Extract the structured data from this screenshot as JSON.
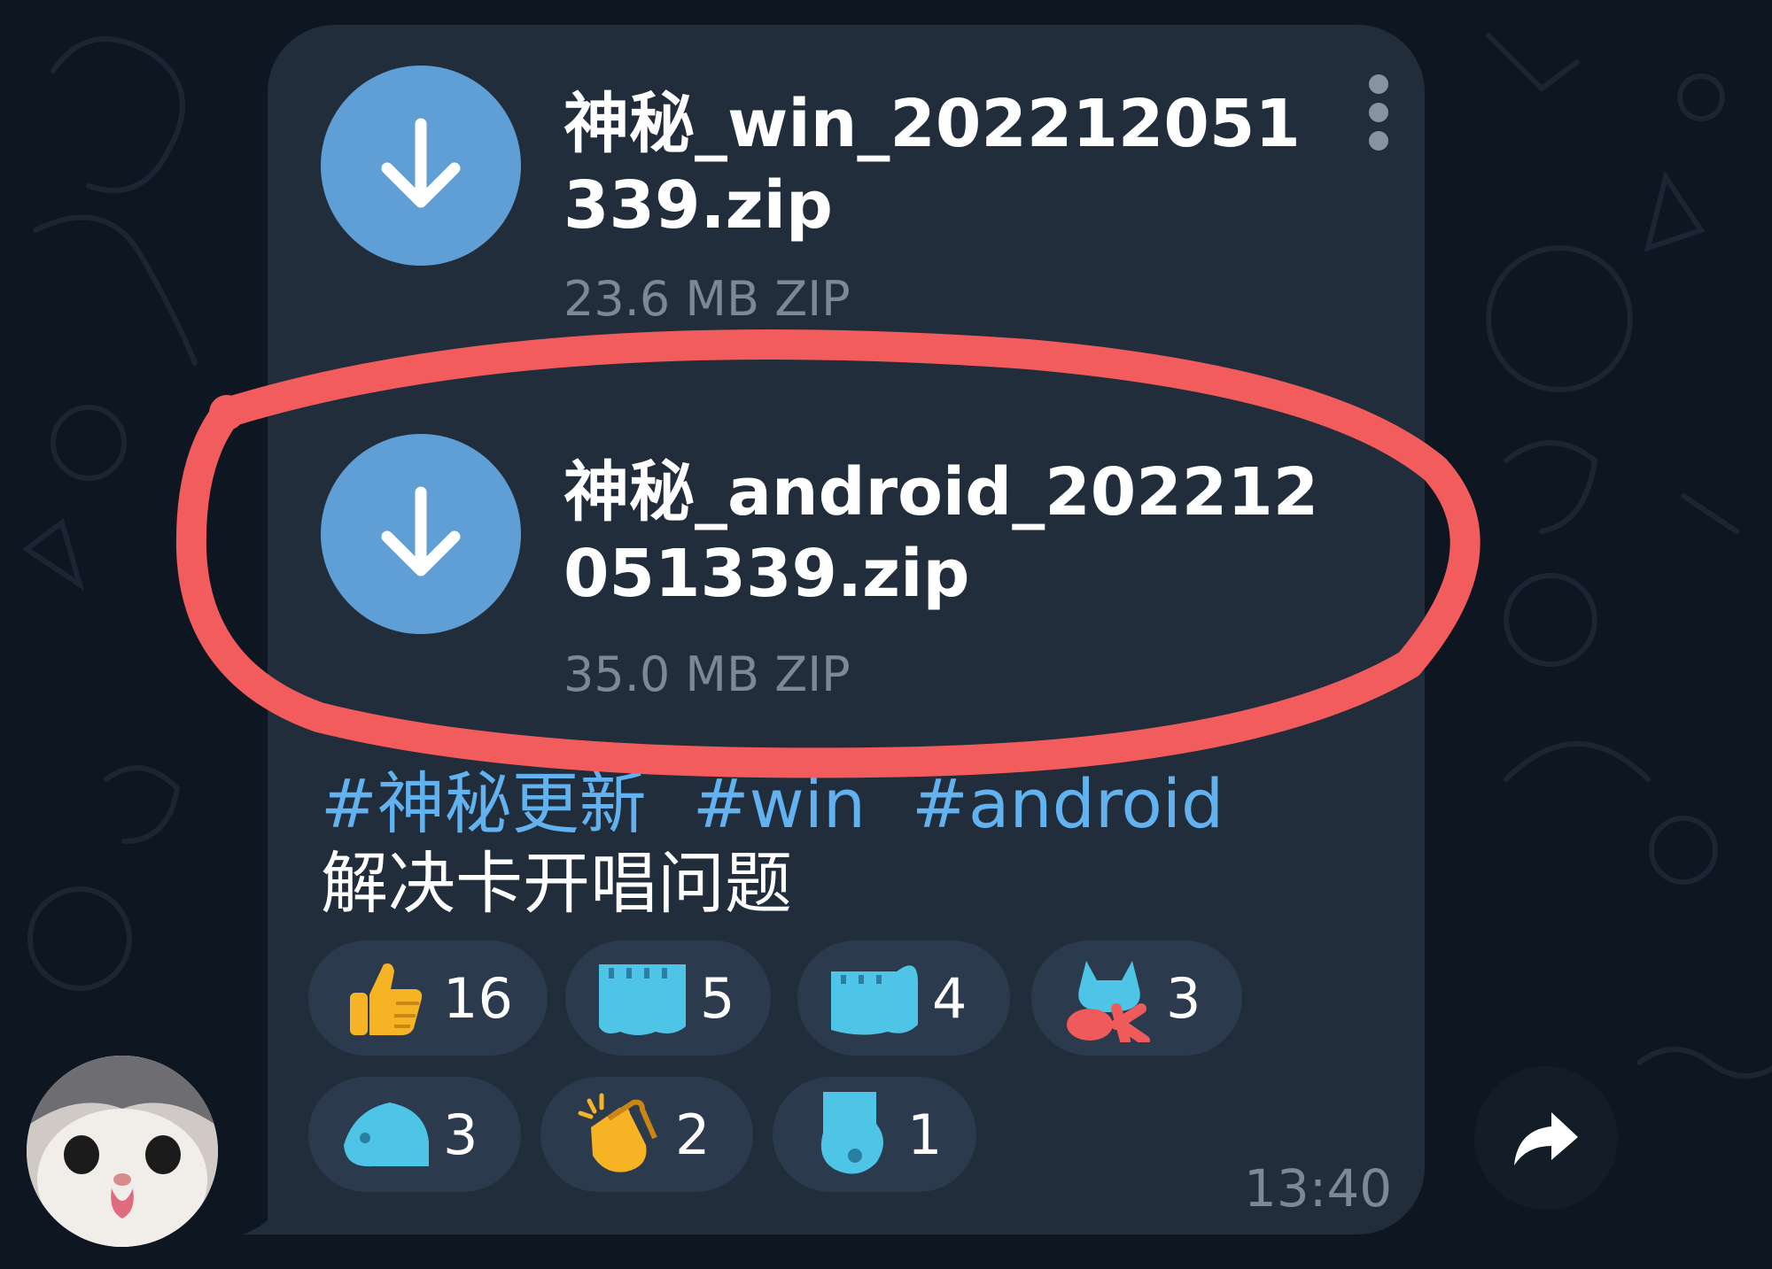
{
  "message": {
    "files": [
      {
        "name": "神秘_win_202212051339.zip",
        "size": "23.6 MB",
        "type": "ZIP"
      },
      {
        "name": "神秘_android_202212051339.zip",
        "size": "35.0 MB",
        "type": "ZIP"
      }
    ],
    "hashtags": [
      "#神秘更新",
      "#win",
      "#android"
    ],
    "text": "解决卡开唱问题",
    "time": "13:40"
  },
  "reactions": [
    {
      "emoji": "thumbs-up",
      "count": "16"
    },
    {
      "emoji": "blue-cat-sticker",
      "count": "5"
    },
    {
      "emoji": "blue-cat-sticker",
      "count": "4"
    },
    {
      "emoji": "ok-cat-sticker",
      "count": "3"
    },
    {
      "emoji": "blue-cat-sticker",
      "count": "3"
    },
    {
      "emoji": "clapping-hands",
      "count": "2"
    },
    {
      "emoji": "blue-cat-sticker",
      "count": "1"
    }
  ],
  "icons": {
    "download": "arrow-down-icon",
    "menu": "vertical-dots-icon",
    "share": "share-arrow-icon",
    "avatar": "cat-avatar"
  },
  "colors": {
    "background": "#0e1621",
    "bubble": "#212d3b",
    "accent": "#5f9fd6",
    "hashtag": "#62b2f0",
    "annotation": "#f25c5c"
  }
}
